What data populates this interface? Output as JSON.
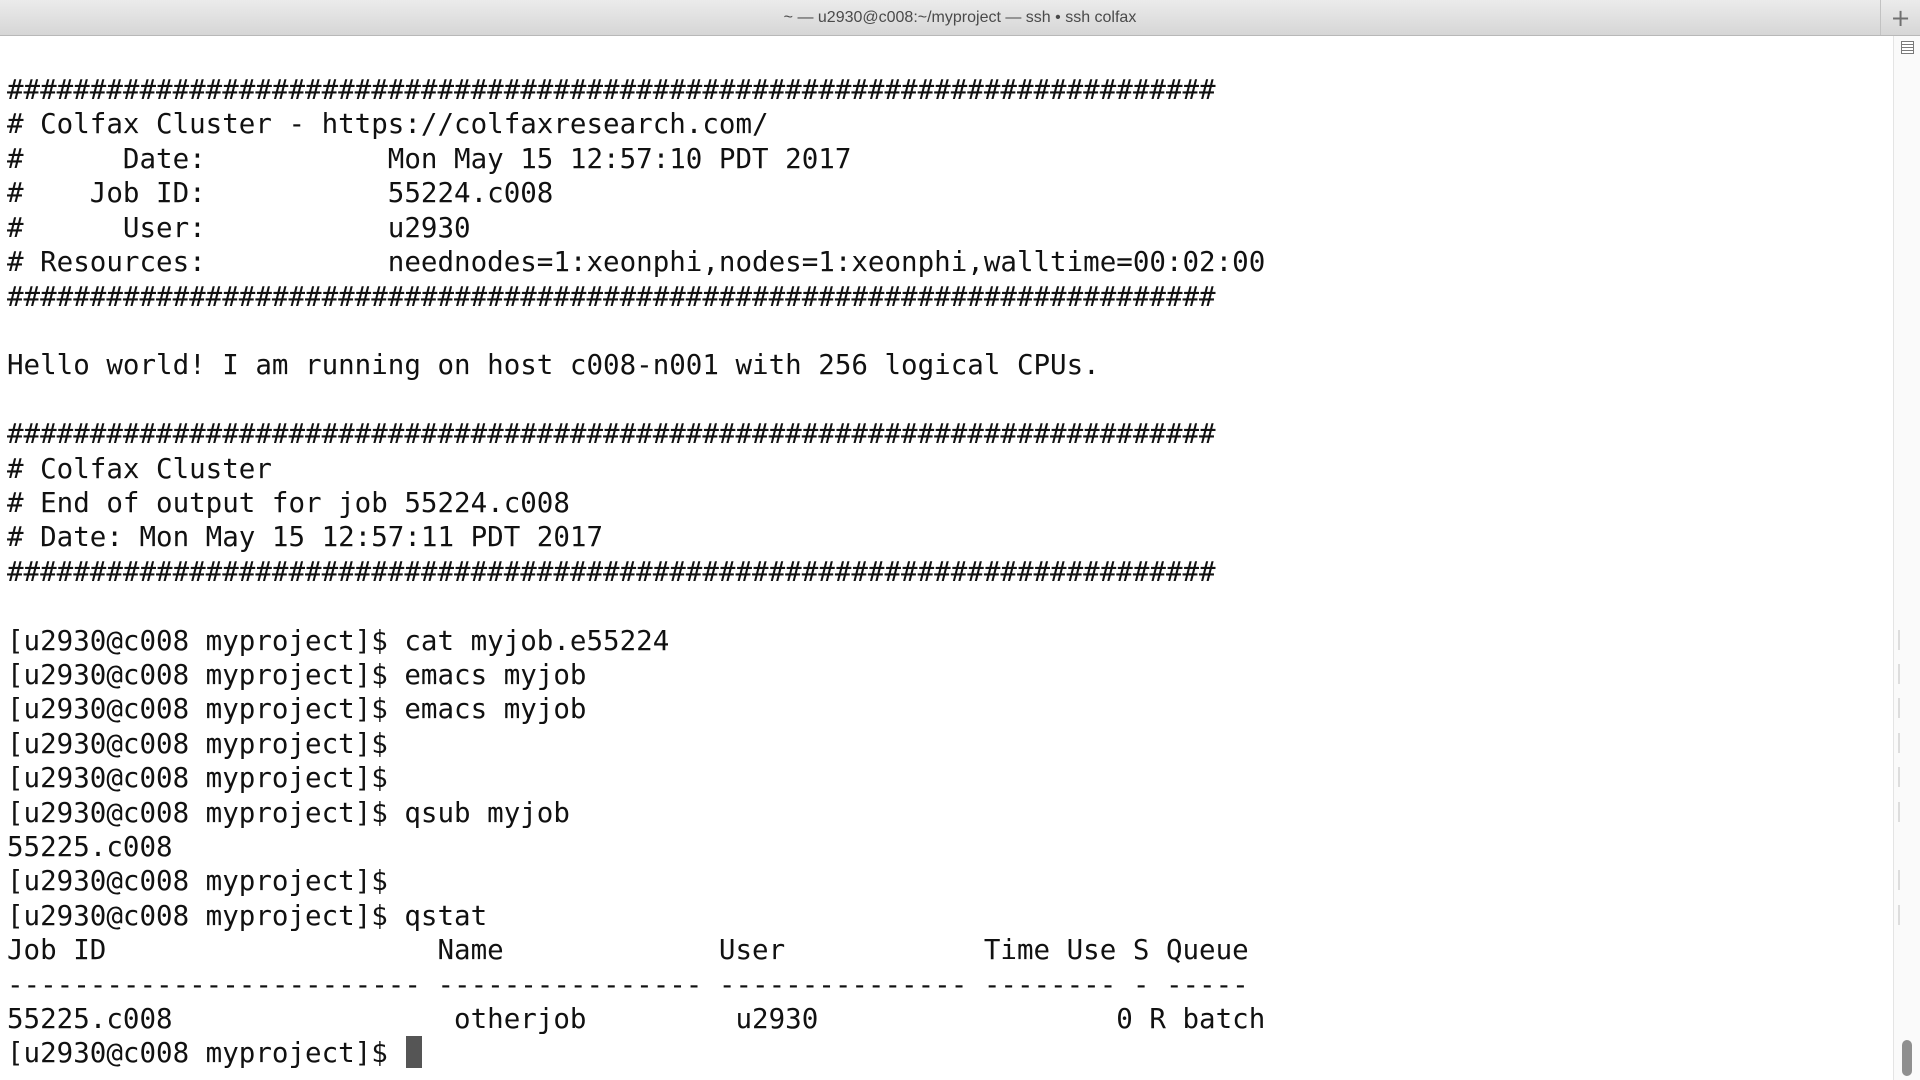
{
  "window": {
    "title": "~ — u2930@c008:~/myproject — ssh • ssh colfax",
    "new_tab_symbol": "+"
  },
  "terminal": {
    "lines": [
      "#########################################################################",
      "# Colfax Cluster - https://colfaxresearch.com/",
      "#      Date:           Mon May 15 12:57:10 PDT 2017",
      "#    Job ID:           55224.c008",
      "#      User:           u2930",
      "# Resources:           neednodes=1:xeonphi,nodes=1:xeonphi,walltime=00:02:00",
      "#########################################################################",
      "",
      "Hello world! I am running on host c008-n001 with 256 logical CPUs.",
      "",
      "#########################################################################",
      "# Colfax Cluster",
      "# End of output for job 55224.c008",
      "# Date: Mon May 15 12:57:11 PDT 2017",
      "#########################################################################",
      "",
      "[u2930@c008 myproject]$ cat myjob.e55224",
      "[u2930@c008 myproject]$ emacs myjob",
      "[u2930@c008 myproject]$ emacs myjob",
      "[u2930@c008 myproject]$",
      "[u2930@c008 myproject]$",
      "[u2930@c008 myproject]$ qsub myjob",
      "55225.c008",
      "[u2930@c008 myproject]$",
      "[u2930@c008 myproject]$ qstat",
      "Job ID                    Name             User            Time Use S Queue",
      "------------------------- ---------------- --------------- -------- - -----",
      "55225.c008                 otherjob         u2930                  0 R batch",
      "[u2930@c008 myproject]$ "
    ]
  }
}
